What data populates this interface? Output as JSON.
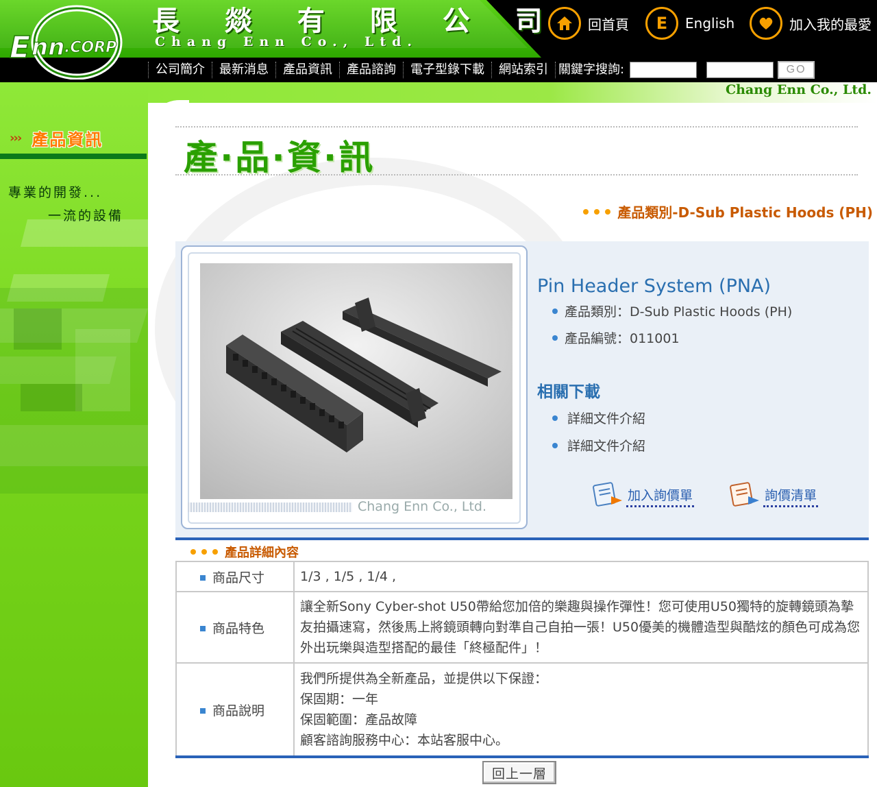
{
  "header": {
    "company_cn": "長 燚 有 限 公 司",
    "company_en": "Chang Enn Co., Ltd.",
    "logo_text": "Enn.CORP",
    "links": [
      {
        "label": "回首頁",
        "icon": "home-icon"
      },
      {
        "label": "English",
        "icon": "english-e-icon",
        "glyph": "E"
      },
      {
        "label": "加入我的最愛",
        "icon": "heart-icon"
      }
    ]
  },
  "nav": {
    "items": [
      "公司簡介",
      "最新消息",
      "產品資訊",
      "產品諮詢",
      "電子型錄下載",
      "網站索引"
    ],
    "search_label": "關鍵字搜詢:",
    "go_label": "GO"
  },
  "tagline": "Chang Enn Co., Ltd.",
  "sidebar": {
    "arrows": "›››",
    "title": "產品資訊",
    "slogan_line1": "專業的開發...",
    "slogan_line2": "一流的設備"
  },
  "main": {
    "heading": "產‧品‧資‧訊",
    "category_path": "產品類別-D-Sub Plastic Hoods (PH)",
    "photo_caption": "Chang Enn Co., Ltd.",
    "product": {
      "name": "Pin Header System (PNA)",
      "category_label": "產品類別：D-Sub Plastic Hoods (PH)",
      "number_label": "產品編號：011001"
    },
    "downloads": {
      "title": "相關下載",
      "items": [
        "詳細文件介紹",
        "詳細文件介紹"
      ]
    },
    "actions": {
      "add_inquiry": "加入詢價單",
      "inquiry_list": "詢價清單"
    },
    "details": {
      "title": "產品詳細內容",
      "rows": [
        {
          "key": "商品尺寸",
          "value": [
            "1/3 , 1/5 , 1/4 ,"
          ]
        },
        {
          "key": "商品特色",
          "value": [
            "讓全新Sony Cyber-shot U50帶給您加倍的樂趣與操作彈性！您可使用U50獨特的旋轉鏡頭為摯友拍攝速寫，然後馬上將鏡頭轉向對準自己自拍一張！U50優美的機體造型與酷炫的顏色可成為您外出玩樂與造型搭配的最佳「終極配件」！"
          ]
        },
        {
          "key": "商品說明",
          "value": [
            "我們所提供為全新產品，並提供以下保證：",
            "保固期：一年",
            "保固範圍：產品故障",
            "顧客諮詢服務中心：本站客服中心。"
          ]
        }
      ]
    },
    "back_button": "回上一層"
  },
  "colors": {
    "header_green": "#3cb800",
    "sidebar_green": "#79d61d",
    "accent_orange": "#f7a000",
    "link_blue": "#2a6fb0",
    "rule_blue": "#2a62b8"
  }
}
